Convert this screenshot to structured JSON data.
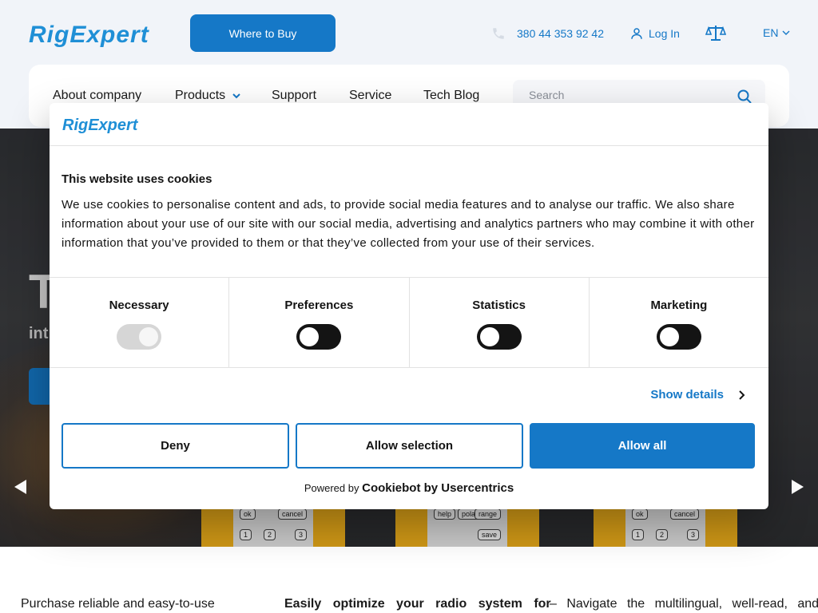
{
  "header": {
    "logo_text": "RigExpert",
    "where_to_buy": "Where to Buy",
    "phone": "380 44 353 92 42",
    "login": "Log In",
    "language": "EN",
    "icons": [
      "phone-icon",
      "user-icon",
      "compare-scales-icon",
      "chevron-down-icon"
    ],
    "accent_color": "#1578c7"
  },
  "nav": {
    "items": [
      {
        "label": "About company"
      },
      {
        "label": "Products"
      },
      {
        "label": "Support"
      },
      {
        "label": "Service"
      },
      {
        "label": "Tech Blog"
      }
    ],
    "search_placeholder": "Search"
  },
  "hero": {
    "title_partial": "T",
    "subtitle_partial": "int",
    "device_keys": [
      "ok",
      "cancel",
      "help",
      "polar",
      "range",
      "save",
      "1",
      "2",
      "3"
    ]
  },
  "cookie_dialog": {
    "logo_text": "RigExpert",
    "title": "This website uses cookies",
    "body": "We use cookies to personalise content and ads, to provide social media features and to analyse our traffic. We also share information about your use of our site with our social media, advertising and analytics partners who may combine it with other information that you’ve provided to them or that they’ve collected from your use of their services.",
    "categories": [
      {
        "label": "Necessary",
        "state": "on-disabled"
      },
      {
        "label": "Preferences",
        "state": "off"
      },
      {
        "label": "Statistics",
        "state": "off"
      },
      {
        "label": "Marketing",
        "state": "off"
      }
    ],
    "show_details": "Show details",
    "deny": "Deny",
    "allow_selection": "Allow selection",
    "allow_all": "Allow all",
    "powered_prefix": "Powered by",
    "powered_brand": "Cookiebot by Usercentrics"
  },
  "content": {
    "col1": "Purchase reliable and easy-to-use",
    "col2": "Easily optimize your radio system for",
    "col3": "– Navigate the multilingual, well-read, and"
  }
}
